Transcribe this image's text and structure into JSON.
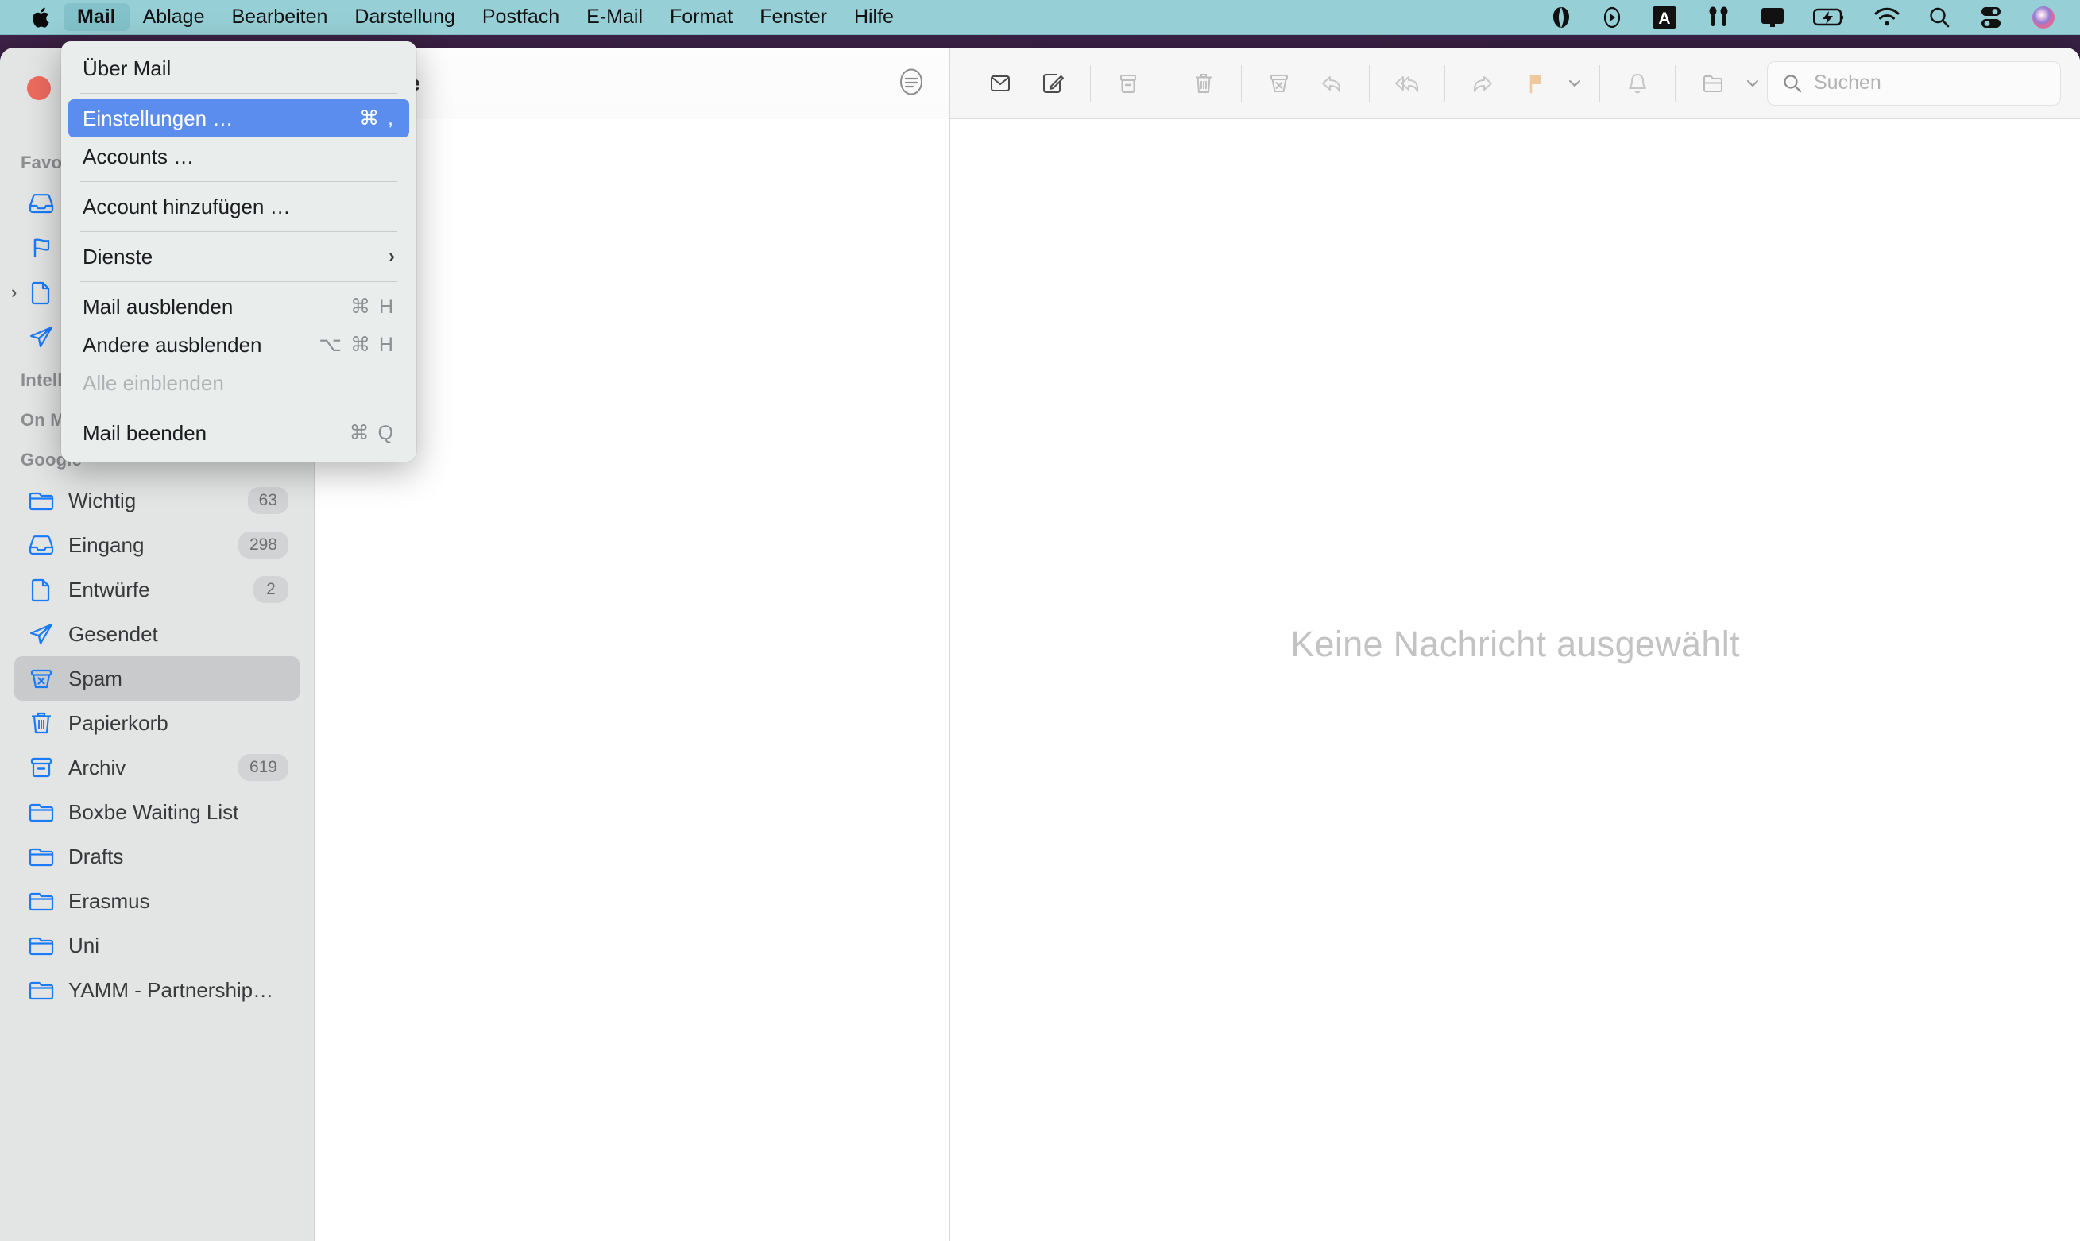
{
  "menubar": {
    "apple_icon": "apple-logo-icon",
    "items": [
      {
        "label": "Mail",
        "active": true
      },
      {
        "label": "Ablage",
        "active": false
      },
      {
        "label": "Bearbeiten",
        "active": false
      },
      {
        "label": "Darstellung",
        "active": false
      },
      {
        "label": "Postfach",
        "active": false
      },
      {
        "label": "E-Mail",
        "active": false
      },
      {
        "label": "Format",
        "active": false
      },
      {
        "label": "Fenster",
        "active": false
      },
      {
        "label": "Hilfe",
        "active": false
      }
    ],
    "status_icons": [
      "location-arrow-icon",
      "play-circle-icon",
      "keyboard-input-a-icon",
      "airpods-icon",
      "screen-mirroring-icon",
      "battery-charging-icon",
      "wifi-icon",
      "spotlight-search-icon",
      "control-center-icon",
      "siri-icon"
    ],
    "background_color": "#97cfd6"
  },
  "dropdown": {
    "title": "Mail",
    "items": [
      {
        "label": "Über Mail",
        "shortcut": "",
        "type": "item"
      },
      {
        "type": "separator"
      },
      {
        "label": "Einstellungen …",
        "shortcut": "⌘ ,",
        "type": "item",
        "highlighted": true
      },
      {
        "label": "Accounts …",
        "shortcut": "",
        "type": "item"
      },
      {
        "type": "separator"
      },
      {
        "label": "Account hinzufügen …",
        "shortcut": "",
        "type": "item"
      },
      {
        "type": "separator"
      },
      {
        "label": "Dienste",
        "shortcut": "",
        "type": "submenu"
      },
      {
        "type": "separator"
      },
      {
        "label": "Mail ausblenden",
        "shortcut": "⌘ H",
        "type": "item"
      },
      {
        "label": "Andere ausblenden",
        "shortcut": "⌥ ⌘ H",
        "type": "item"
      },
      {
        "label": "Alle einblenden",
        "shortcut": "",
        "type": "item",
        "disabled": true
      },
      {
        "type": "separator"
      },
      {
        "label": "Mail beenden",
        "shortcut": "⌘ Q",
        "type": "item"
      }
    ],
    "highlight_color": "#5b8def"
  },
  "sidebar": {
    "sections": [
      {
        "header": "Favoriten",
        "items": [
          {
            "label": "Eingang",
            "icon": "inbox-icon",
            "badge": "",
            "selected": false,
            "disclosure": false
          },
          {
            "label": "Markiert",
            "icon": "flag-icon",
            "badge": "",
            "selected": false,
            "disclosure": false
          },
          {
            "label": "Entwürfe",
            "icon": "drafts-document-icon",
            "badge": "",
            "selected": false,
            "disclosure": true
          },
          {
            "label": "Gesendet",
            "icon": "sent-paperplane-icon",
            "badge": "",
            "selected": false,
            "disclosure": false
          }
        ]
      },
      {
        "header": "Intelligente Postfächer",
        "items": []
      },
      {
        "header": "On My Mac",
        "items": []
      },
      {
        "header": "Google",
        "items": [
          {
            "label": "Wichtig",
            "icon": "folder-icon",
            "badge": "63",
            "selected": false,
            "disclosure": false
          },
          {
            "label": "Eingang",
            "icon": "inbox-icon",
            "badge": "298",
            "selected": false,
            "disclosure": false
          },
          {
            "label": "Entwürfe",
            "icon": "drafts-document-icon",
            "badge": "2",
            "selected": false,
            "disclosure": false
          },
          {
            "label": "Gesendet",
            "icon": "sent-paperplane-icon",
            "badge": "",
            "selected": false,
            "disclosure": false
          },
          {
            "label": "Spam",
            "icon": "junk-bin-icon",
            "badge": "",
            "selected": true,
            "disclosure": false
          },
          {
            "label": "Papierkorb",
            "icon": "trash-icon",
            "badge": "",
            "selected": false,
            "disclosure": false
          },
          {
            "label": "Archiv",
            "icon": "archive-box-icon",
            "badge": "619",
            "selected": false,
            "disclosure": false
          },
          {
            "label": "Boxbe Waiting List",
            "icon": "folder-icon",
            "badge": "",
            "selected": false,
            "disclosure": false
          },
          {
            "label": "Drafts",
            "icon": "folder-icon",
            "badge": "",
            "selected": false,
            "disclosure": false
          },
          {
            "label": "Erasmus",
            "icon": "folder-icon",
            "badge": "",
            "selected": false,
            "disclosure": false
          },
          {
            "label": "Uni",
            "icon": "folder-icon",
            "badge": "",
            "selected": false,
            "disclosure": false
          },
          {
            "label": "YAMM - Partnership…",
            "icon": "folder-icon",
            "badge": "",
            "selected": false,
            "disclosure": false
          }
        ]
      }
    ],
    "accent_color": "#1a7af8",
    "selected_row_color": "#c9cacb"
  },
  "message_list": {
    "title": "Google",
    "sort_icon": "sort-filter-icon",
    "messages": []
  },
  "toolbar": {
    "buttons": [
      {
        "name": "mark-unread-envelope-icon",
        "label": "Als ungelesen markieren"
      },
      {
        "name": "compose-new-message-icon",
        "label": "Neue E-Mail"
      },
      {
        "name": "archive-icon",
        "label": "Archivieren"
      },
      {
        "name": "delete-trash-icon",
        "label": "Löschen"
      },
      {
        "name": "junk-icon",
        "label": "Als Werbung markieren"
      },
      {
        "name": "reply-icon",
        "label": "Antworten"
      },
      {
        "name": "reply-all-icon",
        "label": "Allen antworten"
      },
      {
        "name": "forward-icon",
        "label": "Weiterleiten"
      },
      {
        "name": "flag-icon",
        "label": "Markieren"
      },
      {
        "name": "mute-bell-icon",
        "label": "Stummschalten"
      },
      {
        "name": "move-to-folder-icon",
        "label": "Bewegen nach"
      }
    ],
    "flag_color": "#efc89c"
  },
  "search": {
    "placeholder": "Suchen",
    "value": "",
    "icon": "search-magnifier-icon"
  },
  "content": {
    "empty_state_text": "Keine Nachricht ausgewählt"
  },
  "window": {
    "close_button_color": "#ed6a5e"
  }
}
